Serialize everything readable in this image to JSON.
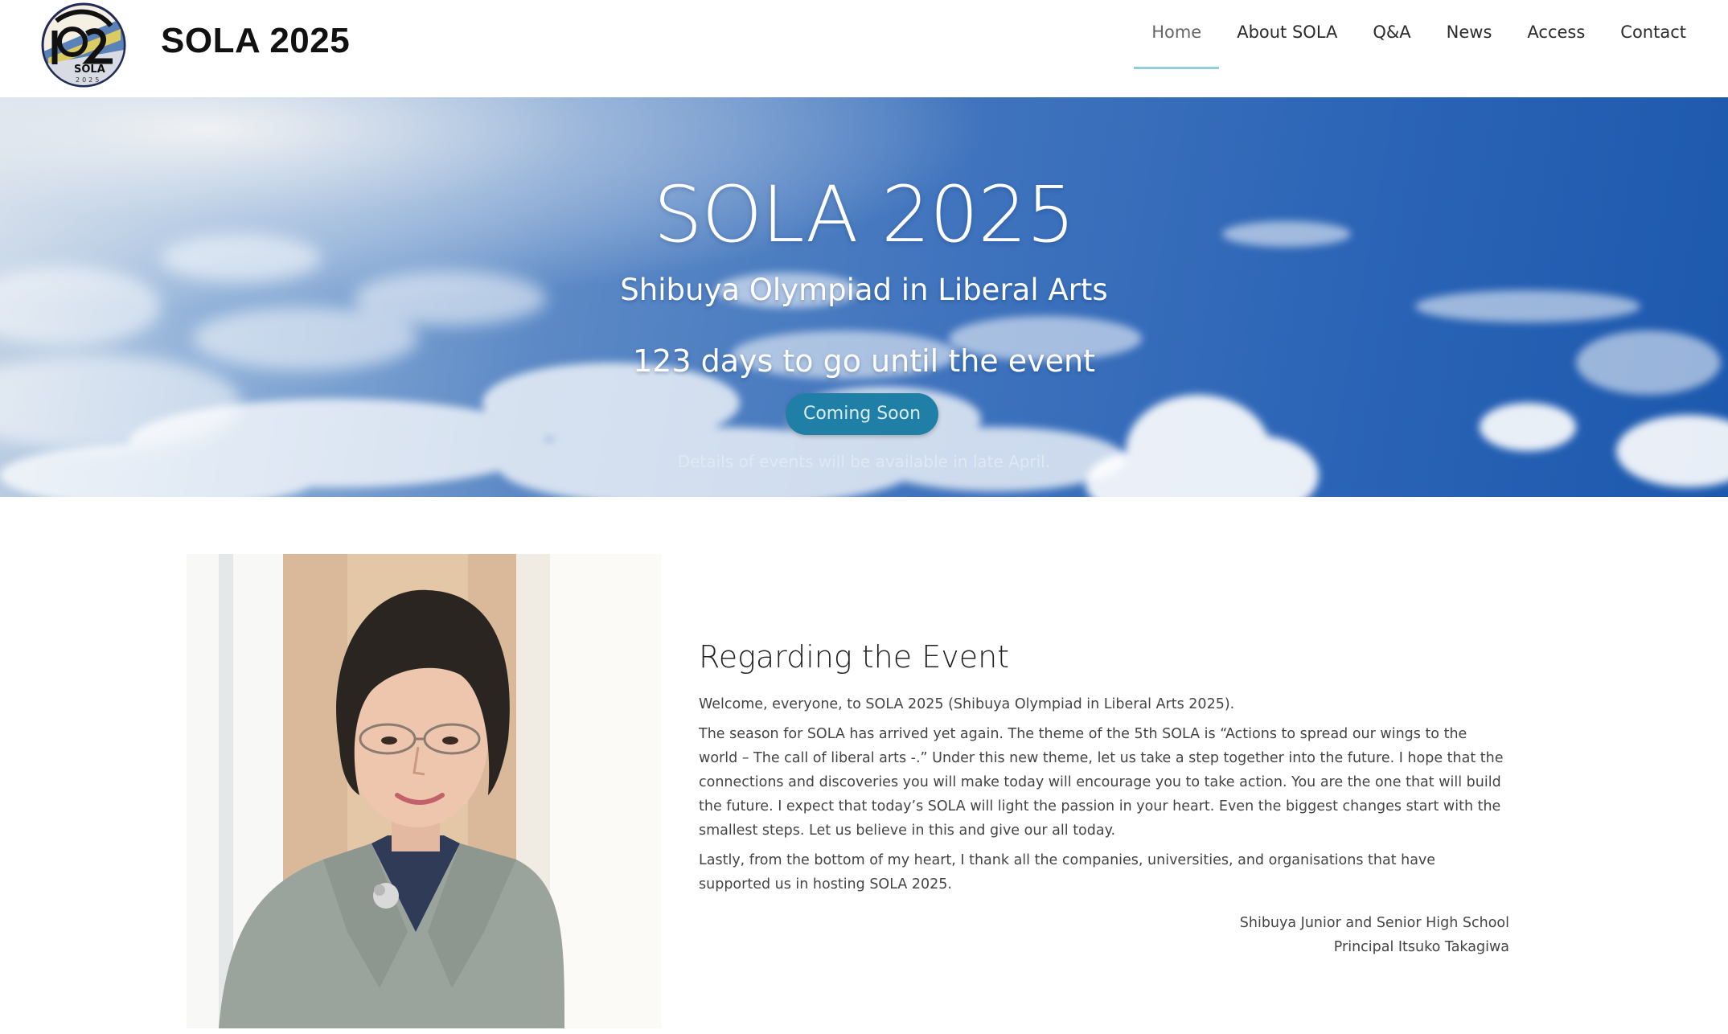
{
  "site": {
    "title": "SOLA 2025",
    "logo_icon": "sola-2025-logo",
    "logo_text": {
      "number": "10",
      "brand": "SOLA",
      "year": "2025"
    }
  },
  "nav": {
    "items": [
      {
        "label": "Home",
        "active": true
      },
      {
        "label": "About SOLA",
        "active": false
      },
      {
        "label": "Q&A",
        "active": false
      },
      {
        "label": "News",
        "active": false
      },
      {
        "label": "Access",
        "active": false
      },
      {
        "label": "Contact",
        "active": false
      }
    ],
    "active_underline_color": "#8fd0dc"
  },
  "hero": {
    "title": "SOLA 2025",
    "subtitle": "Shibuya Olympiad in Liberal Arts",
    "countdown": "123 days to go until the event",
    "button_label": "Coming Soon",
    "note": "Details of events will be available in late April.",
    "background": "blue-sky-with-clouds",
    "button_color": "#1f7fa6"
  },
  "message": {
    "portrait": "principal-portrait-photo",
    "heading": "Regarding the Event",
    "paragraphs": [
      "Welcome, everyone, to SOLA 2025 (Shibuya Olympiad in Liberal Arts 2025).",
      "The season for SOLA has arrived yet again. The theme of the 5th SOLA is “Actions to spread our wings to the world – The call of liberal arts -.” Under this new theme, let us take a step together into the future. I hope that the connections and discoveries you will make today will encourage you to take action. You are the one that will build the future. I expect that today’s SOLA will light the passion in your heart. Even the biggest changes start with the smallest steps. Let us believe in this and give our all today.",
      "Lastly, from the bottom of my heart, I thank all the companies, universities, and organisations that have supported us in hosting SOLA 2025."
    ],
    "signature": {
      "school": "Shibuya Junior and Senior High School",
      "name": "Principal Itsuko Takagiwa"
    }
  }
}
